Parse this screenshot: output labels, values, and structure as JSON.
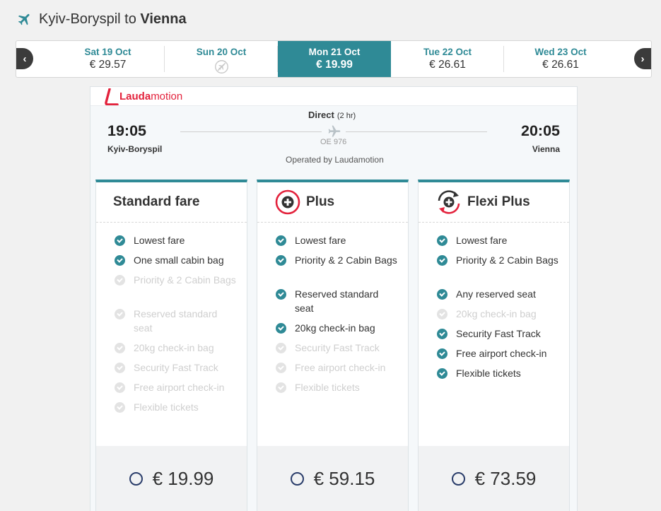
{
  "header": {
    "from": "Kyiv-Boryspil",
    "to_word": "to",
    "to": "Vienna"
  },
  "dates": [
    {
      "day": "Sat 19 Oct",
      "price": "€ 29.57",
      "active": false,
      "available": true
    },
    {
      "day": "Sun 20 Oct",
      "price": "",
      "active": false,
      "available": false
    },
    {
      "day": "Mon 21 Oct",
      "price": "€ 19.99",
      "active": true,
      "available": true
    },
    {
      "day": "Tue 22 Oct",
      "price": "€ 26.61",
      "active": false,
      "available": true
    },
    {
      "day": "Wed 23 Oct",
      "price": "€ 26.61",
      "active": false,
      "available": true
    }
  ],
  "nav": {
    "prev": "‹",
    "next": "›"
  },
  "flight": {
    "airline_prefix": "Lauda",
    "airline_suffix": "motion",
    "depart_time": "19:05",
    "depart_city": "Kyiv-Boryspil",
    "arrive_time": "20:05",
    "arrive_city": "Vienna",
    "direct": "Direct",
    "duration": "(2 hr)",
    "flight_number": "OE 976",
    "operated_by": "Operated by Laudamotion"
  },
  "fares": [
    {
      "title": "Standard fare",
      "price": "€ 19.99",
      "features": [
        {
          "text": "Lowest fare",
          "included": true
        },
        {
          "text": "One small cabin bag",
          "included": true
        },
        {
          "text": "Priority & 2 Cabin Bags",
          "included": false
        },
        {
          "text": "Reserved standard seat",
          "included": false
        },
        {
          "text": "20kg check-in bag",
          "included": false
        },
        {
          "text": "Security Fast Track",
          "included": false
        },
        {
          "text": "Free airport check-in",
          "included": false
        },
        {
          "text": "Flexible tickets",
          "included": false
        }
      ]
    },
    {
      "title": "Plus",
      "price": "€ 59.15",
      "features": [
        {
          "text": "Lowest fare",
          "included": true
        },
        {
          "text": "Priority & 2 Cabin Bags",
          "included": true
        },
        {
          "text": "Reserved standard seat",
          "included": true
        },
        {
          "text": "20kg check-in bag",
          "included": true
        },
        {
          "text": "Security Fast Track",
          "included": false
        },
        {
          "text": "Free airport check-in",
          "included": false
        },
        {
          "text": "Flexible tickets",
          "included": false
        }
      ]
    },
    {
      "title": "Flexi Plus",
      "price": "€ 73.59",
      "features": [
        {
          "text": "Lowest fare",
          "included": true
        },
        {
          "text": "Priority & 2 Cabin Bags",
          "included": true
        },
        {
          "text": "Any reserved seat",
          "included": true
        },
        {
          "text": "20kg check-in bag",
          "included": false
        },
        {
          "text": "Security Fast Track",
          "included": true
        },
        {
          "text": "Free airport check-in",
          "included": true
        },
        {
          "text": "Flexible tickets",
          "included": true
        }
      ]
    }
  ],
  "colors": {
    "accent": "#2f8a96",
    "brand": "#e3223c",
    "radio": "#2a3d6a"
  },
  "icons": {
    "header": "plane-icon",
    "no_flight": "no-flight-icon",
    "plus": "plus-circle-icon",
    "flexi": "flexi-refresh-icon",
    "check": "check-circle-icon"
  }
}
